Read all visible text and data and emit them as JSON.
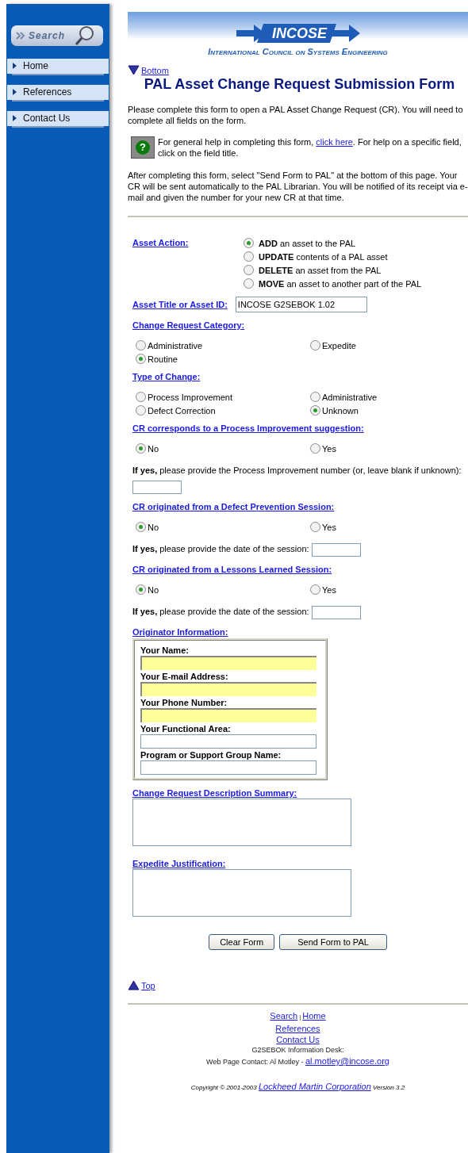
{
  "sidebar": {
    "search_button": "Search",
    "items": [
      {
        "label": "Home"
      },
      {
        "label": "References"
      },
      {
        "label": "Contact Us"
      }
    ]
  },
  "header": {
    "logo": "INCOSE",
    "subtitle": "International Council on Systems Engineering"
  },
  "bottom_link": "Bottom",
  "title": "PAL Asset Change Request Submission Form",
  "intro": "Please complete this form to open a PAL Asset Change Request (CR). You will need to complete all fields on the form.",
  "help": {
    "icon_glyph": "?",
    "text_before": "For general help in completing this form, ",
    "link": "click here",
    "text_after": ". For help on a specific field, click on the field title."
  },
  "instructions": "After completing this form, select \"Send Form to PAL\" at the bottom of this page. Your CR will be sent automatically to the PAL Librarian. You will be notified of its receipt via e-mail and given the number for your new CR at that time.",
  "form": [
    {
      "kind": "radio_stack",
      "label": "Asset Action:",
      "options": [
        {
          "text": "**ADD** an asset to the PAL",
          "selected": true
        },
        {
          "text": "**UPDATE** contents of a PAL asset",
          "selected": false
        },
        {
          "text": "**DELETE** an asset from the PAL",
          "selected": false
        },
        {
          "text": "**MOVE** an asset to another part of the PAL",
          "selected": false
        }
      ]
    },
    {
      "kind": "text_field",
      "label": "Asset Title or Asset ID:",
      "value": "INCOSE G2SEBOK 1.02"
    },
    {
      "kind": "radio_grid",
      "label": "Change Request Category:",
      "options": [
        {
          "text": "Administrative",
          "selected": false
        },
        {
          "text": "Expedite",
          "selected": false
        },
        {
          "text": "Routine",
          "selected": true
        }
      ]
    },
    {
      "kind": "radio_grid",
      "label": "Type of Change:",
      "options": [
        {
          "text": "Process Improvement",
          "selected": false
        },
        {
          "text": "Administrative",
          "selected": false
        },
        {
          "text": "Defect Correction",
          "selected": false
        },
        {
          "text": "Unknown",
          "selected": true
        }
      ]
    },
    {
      "kind": "radio_grid",
      "label": "CR corresponds to a Process Improvement suggestion:",
      "options": [
        {
          "text": "No",
          "selected": true
        },
        {
          "text": "Yes",
          "selected": false
        }
      ],
      "followup": "**If yes,** please provide the Process Improvement number (or, leave blank if unknown):"
    },
    {
      "kind": "radio_grid",
      "label": "CR originated from a Defect Prevention Session:",
      "options": [
        {
          "text": "No",
          "selected": true
        },
        {
          "text": "Yes",
          "selected": false
        }
      ],
      "followup": "**If yes,** please provide the date of the session:"
    },
    {
      "kind": "radio_grid",
      "label": "CR originated from a Lessons Learned Session:",
      "options": [
        {
          "text": "No",
          "selected": true
        },
        {
          "text": "Yes",
          "selected": false
        }
      ],
      "followup": "**If yes,** please provide the date of the session:"
    },
    {
      "kind": "group",
      "label": "Originator Information:",
      "fields": [
        {
          "label": "Your Name:",
          "required": true
        },
        {
          "label": "Your E-mail Address:",
          "required": true
        },
        {
          "label": "Your Phone Number:",
          "required": true
        },
        {
          "label": "Your Functional Area:",
          "required": false
        },
        {
          "label": "Program or Support Group Name:",
          "required": false
        }
      ]
    },
    {
      "kind": "textarea",
      "label": "Change Request Description Summary:"
    },
    {
      "kind": "textarea",
      "label": "Expedite Justification:"
    }
  ],
  "buttons": [
    "Clear Form",
    "Send Form to PAL"
  ],
  "top_link": "Top",
  "footer": {
    "links_first": [
      "Search",
      "Home"
    ],
    "separator": "|",
    "links_more": [
      "References",
      "Contact Us"
    ],
    "desk": "G2SEBOK Information Desk:",
    "contact_text": "Web Page Contact: Al Motley - ",
    "contact_email": "al.motley@incose.org",
    "copyright": "Copyright © 2001-2003 ",
    "company": "Lockheed Martin Corporation",
    "version": " Version 3.2"
  }
}
